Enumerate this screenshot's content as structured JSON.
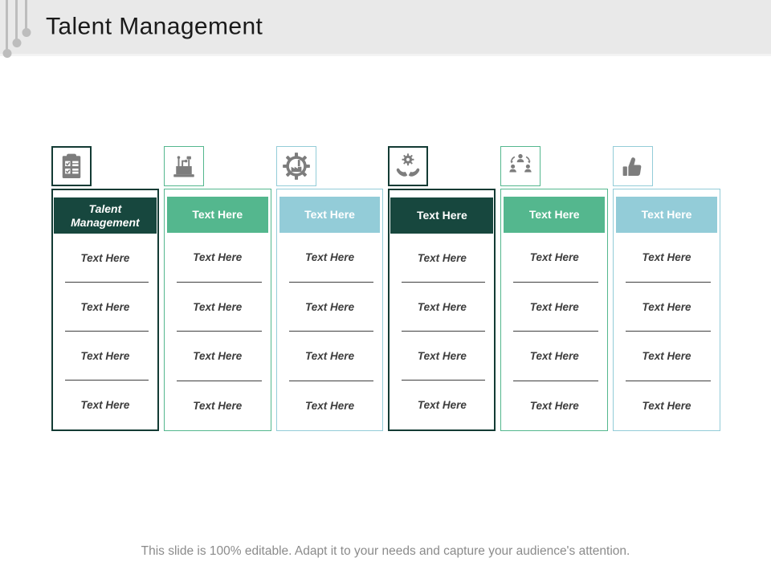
{
  "title": "Talent Management",
  "footer": "This slide is 100% editable. Adapt it to your needs and capture your audience's attention.",
  "colors": {
    "titlebar_bg": "#e9e9e9",
    "pin_gray": "#bdbdbd",
    "dark_teal": "#17473e",
    "dark_border": "#133b34",
    "green": "#54b78e",
    "light_blue": "#93ccd8",
    "icon_gray": "#7d7d7d",
    "body_text": "#3d3d3d",
    "separator": "#3e3e3e",
    "footer_text": "#8b8b8b"
  },
  "columns": [
    {
      "icon": "clipboard-checklist-icon",
      "theme": "dark",
      "header": "Talent Management",
      "rows": [
        "Text Here",
        "Text Here",
        "Text Here",
        "Text Here"
      ]
    },
    {
      "icon": "machine-automation-icon",
      "theme": "green",
      "header": "Text Here",
      "rows": [
        "Text Here",
        "Text Here",
        "Text Here",
        "Text Here"
      ]
    },
    {
      "icon": "gear-factory-icon",
      "theme": "blue",
      "header": "Text Here",
      "rows": [
        "Text Here",
        "Text Here",
        "Text Here",
        "Text Here"
      ]
    },
    {
      "icon": "hands-gear-icon",
      "theme": "dark",
      "header": "Text Here",
      "rows": [
        "Text Here",
        "Text Here",
        "Text Here",
        "Text Here"
      ]
    },
    {
      "icon": "team-hierarchy-icon",
      "theme": "green",
      "header": "Text Here",
      "rows": [
        "Text Here",
        "Text Here",
        "Text Here",
        "Text Here"
      ]
    },
    {
      "icon": "thumbs-up-icon",
      "theme": "blue",
      "header": "Text Here",
      "rows": [
        "Text Here",
        "Text Here",
        "Text Here",
        "Text Here"
      ]
    }
  ]
}
